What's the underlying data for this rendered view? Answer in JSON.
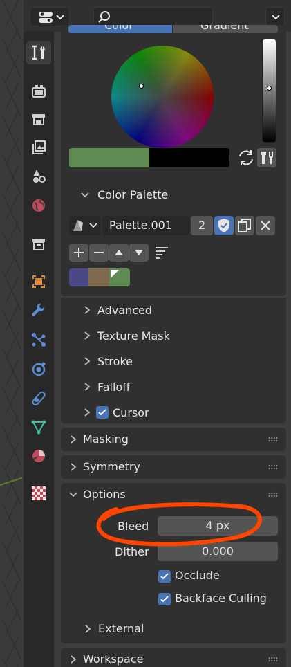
{
  "header": {
    "editor_type_icon": "properties-editor-icon",
    "search_icon": "search-icon",
    "menu_icon": "chevron-down-icon"
  },
  "tabs": [
    {
      "name": "tool",
      "icon": "tool-icon",
      "active": true
    },
    {
      "name": "render",
      "icon": "render-icon"
    },
    {
      "name": "output",
      "icon": "output-icon"
    },
    {
      "name": "view-layer",
      "icon": "view-layer-icon"
    },
    {
      "name": "scene",
      "icon": "scene-icon"
    },
    {
      "name": "world",
      "icon": "world-icon"
    },
    {
      "name": "collection",
      "icon": "collection-icon"
    },
    {
      "name": "object",
      "icon": "object-icon"
    },
    {
      "name": "modifiers",
      "icon": "wrench-icon"
    },
    {
      "name": "particles",
      "icon": "particles-icon"
    },
    {
      "name": "physics",
      "icon": "physics-icon"
    },
    {
      "name": "constraints",
      "icon": "constraints-icon"
    },
    {
      "name": "data",
      "icon": "mesh-data-icon"
    },
    {
      "name": "material",
      "icon": "material-icon"
    },
    {
      "name": "texture",
      "icon": "texture-icon"
    }
  ],
  "color_tabs": {
    "color": "Color",
    "gradient": "Gradient"
  },
  "colors": {
    "primary_swatch": "#5f8a52",
    "secondary_swatch": "#000000",
    "accent": "#4772b3",
    "palette": [
      "#4b4887",
      "#7f6a4f",
      "#5f8a52"
    ]
  },
  "color_palette": {
    "title": "Color Palette",
    "name": "Palette.001",
    "users": "2"
  },
  "sections": {
    "advanced": "Advanced",
    "texture_mask": "Texture Mask",
    "stroke": "Stroke",
    "falloff": "Falloff",
    "cursor": "Cursor",
    "masking": "Masking",
    "symmetry": "Symmetry",
    "options": "Options",
    "external": "External",
    "workspace": "Workspace"
  },
  "options": {
    "bleed_label": "Bleed",
    "bleed_value": "4 px",
    "dither_label": "Dither",
    "dither_value": "0.000",
    "occlude_label": "Occlude",
    "occlude_checked": true,
    "backface_label": "Backface Culling",
    "backface_checked": true
  },
  "cursor_checked": true,
  "annotation_color": "#ff4500"
}
